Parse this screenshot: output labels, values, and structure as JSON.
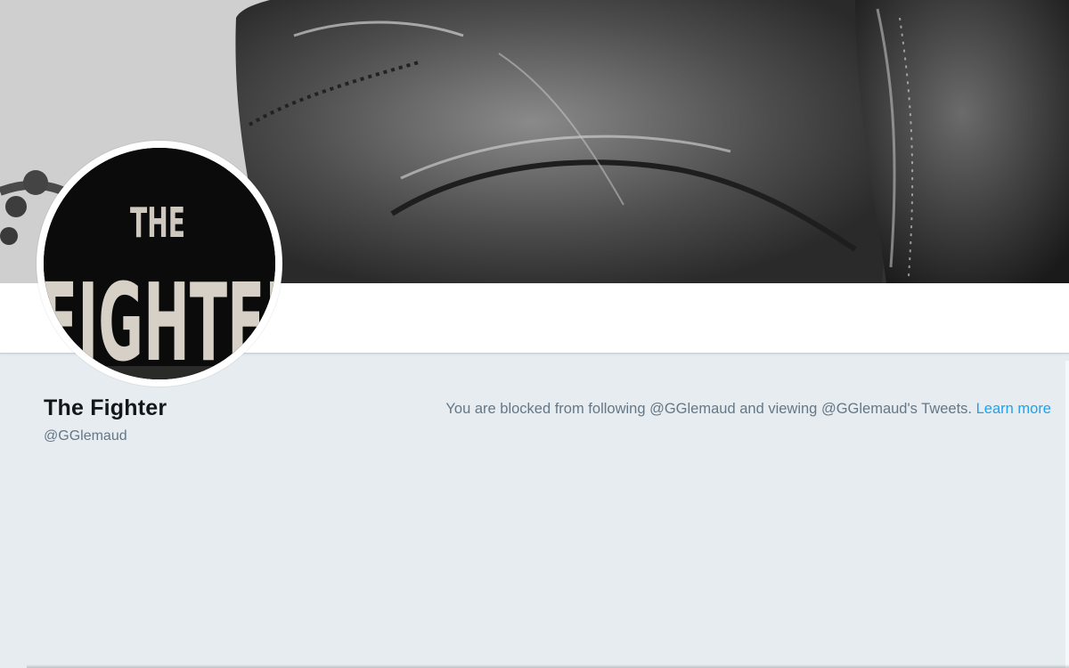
{
  "profile": {
    "display_name": "The Fighter",
    "handle": "@GGlemaud"
  },
  "avatar": {
    "image_text_line1": "THE",
    "image_text_line2": "FIGHTER"
  },
  "blocked_notice": {
    "message": "You are blocked from following @GGlemaud and viewing @GGlemaud's Tweets.",
    "learn_more_label": "Learn more"
  },
  "colors": {
    "background": "#e6ecf0",
    "name": "#14171a",
    "muted": "#657786",
    "link": "#1da1f2"
  }
}
